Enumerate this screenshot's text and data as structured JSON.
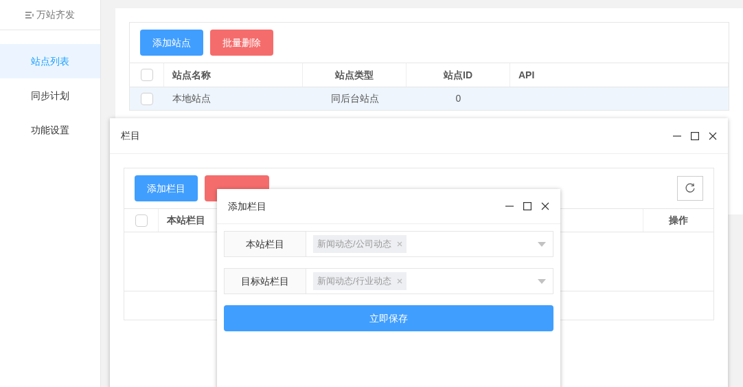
{
  "sidebar": {
    "logo": "万站齐发",
    "items": [
      {
        "label": "站点列表",
        "selected": true
      },
      {
        "label": "同步计划",
        "selected": false
      },
      {
        "label": "功能设置",
        "selected": false
      }
    ]
  },
  "sites": {
    "select_all_checked": false,
    "buttons": [
      {
        "label": "添加站点",
        "kind": "primary"
      },
      {
        "label": "批量删除",
        "kind": "danger"
      }
    ],
    "columns": [
      "站点名称",
      "站点类型",
      "站点ID",
      "API"
    ],
    "rows": [
      {
        "checked": false,
        "cells": [
          "本地站点",
          "同后台站点",
          "0",
          ""
        ]
      }
    ]
  },
  "column_dialog": {
    "title": "栏目",
    "select_all_checked": false,
    "buttons": [
      {
        "label": "添加栏目",
        "kind": "primary"
      },
      {
        "kind": "danger"
      }
    ],
    "columns": [
      "本站栏目",
      "操作"
    ]
  },
  "add_dialog": {
    "title": "添加栏目",
    "fields": [
      {
        "label": "本站栏目",
        "tag": "新闻动态/公司动态"
      },
      {
        "label": "目标站栏目",
        "tag": "新闻动态/行业动态"
      }
    ],
    "save": "立即保存"
  }
}
